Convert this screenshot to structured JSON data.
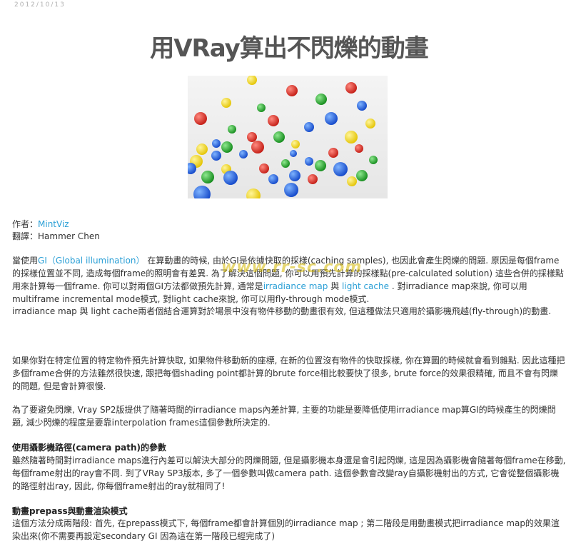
{
  "post": {
    "date": "2012/10/13",
    "title": "用VRay算出不閃爍的動畫"
  },
  "meta": {
    "author_label": "作者：",
    "author_name": "MintViz",
    "translator_label": "翻譯：",
    "translator_name": "Hammer Chen"
  },
  "watermark": "www.rr-sc.com",
  "body": {
    "p1_pre": "當使用",
    "p1_link": "GI（Global illumination）",
    "p1_a": " 在算動畫的時候, 由於GI是依據快取的採樣(caching samples), 也因此會產生閃爍的問題. 原因是每個frame的採樣位置並不同, 造成每個frame的照明會有差異. 為了解決這個問題, 你可以用預先計算的採樣點(pre-calculated solution) 這些合併的採樣點用來計算每一個frame. 你可以對兩個GI方法都做預先計算, 通常是",
    "p1_link2": "irradiance map",
    "p1_and": " 與 ",
    "p1_link3": "light cache",
    "p1_b": " . 對irradiance map來說, 你可以用multiframe incremental mode模式, 對light cache來說, 你可以用fly-through mode模式.",
    "p2": "irradiance map 與 light cache兩者個結合運算對於場景中沒有物件移動的動畫很有效, 但這種做法只適用於攝影機飛越(fly-through)的動畫.",
    "p3": "如果你對在特定位置的特定物件預先計算快取, 如果物件移動新的座標, 在新的位置沒有物件的快取採樣, 你在算圖的時候就會看到雜點. 因此這種把多個frame合併的方法雖然很快速, 跟把每個shading point都計算的brute force相比較要快了很多, brute force的效果很精確, 而且不會有閃爍的問題, 但是會計算很慢.",
    "p4": "為了要避免閃爍, Vray SP2版提供了隨著時間的irradiance maps內差計算, 主要的功能是要降低使用irradiance map算GI的時候產生的閃爍問題, 減少閃爍的程度是要靠interpolation frames這個參數所決定的.",
    "h1": "使用攝影機路徑(camera path)的參數",
    "p5": "雖然隨著時間對irradiance maps進行內差可以解決大部分的閃爍問題, 但是攝影機本身還是會引起閃爍, 這是因為攝影機會隨著每個frame在移動, 每個frame射出的ray會不同. 到了VRay SP3版本, 多了一個參數叫做camera path. 這個參數會改變ray自攝影機射出的方式, 它會從整個攝影機的路徑射出ray, 因此, 你每個frame射出的ray就相同了!",
    "h2": "動畫prepass與動畫渲染模式",
    "p6": "這個方法分成兩階段: 首先, 在prepass模式下, 每個frame都會計算個別的irradiance map ; 第二階段是用動畫模式把irradiance map的效果渲染出來(你不需要再設定secondary GI 因為這在第一階段已經完成了)"
  },
  "colors": {
    "link": "#2a9fd6",
    "title": "#555555",
    "text": "#333333"
  }
}
